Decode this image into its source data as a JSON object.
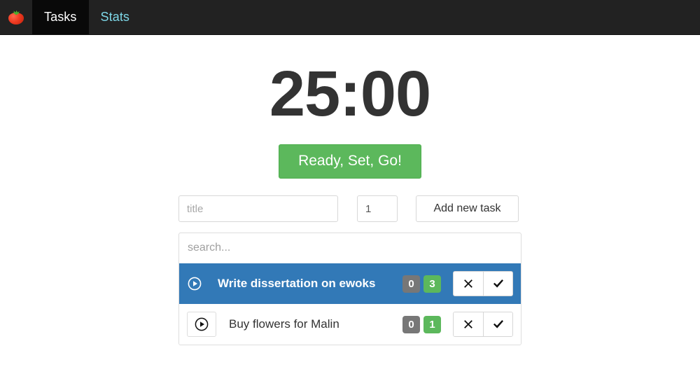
{
  "navbar": {
    "brand_icon": "tomato-icon",
    "items": [
      {
        "label": "Tasks",
        "active": true
      },
      {
        "label": "Stats",
        "active": false
      }
    ]
  },
  "timer": {
    "display": "25:00",
    "start_button": "Ready, Set, Go!"
  },
  "add_form": {
    "title_placeholder": "title",
    "title_value": "",
    "count_value": "1",
    "count_placeholder": "",
    "add_button": "Add new task"
  },
  "task_list": {
    "search_placeholder": "search...",
    "search_value": "",
    "tasks": [
      {
        "title": "Write dissertation on ewoks",
        "done_count": "0",
        "total_count": "3",
        "selected": true,
        "play_icon": "play-circle-icon",
        "delete_icon": "close-icon",
        "complete_icon": "check-icon"
      },
      {
        "title": "Buy flowers for Malin",
        "done_count": "0",
        "total_count": "1",
        "selected": false,
        "play_icon": "play-circle-icon",
        "delete_icon": "close-icon",
        "complete_icon": "check-icon"
      }
    ]
  },
  "colors": {
    "navbar_bg": "#222222",
    "navbar_active_bg": "#090909",
    "nav_link": "#7ed8e8",
    "accent_green": "#5cb85c",
    "selected_blue": "#3279b7",
    "badge_gray": "#777777",
    "timer_text": "#333333"
  }
}
